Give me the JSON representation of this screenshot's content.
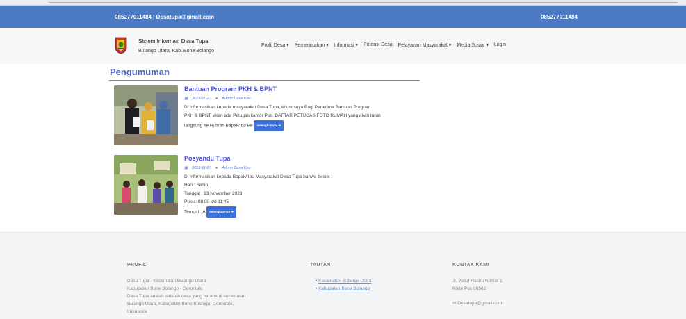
{
  "topbar": {
    "contact_left": "085277011484 | Desatupa@gmail.com",
    "contact_right": "085277011484"
  },
  "brand": {
    "title": "Sistem Informasi Desa Tupa",
    "subtitle": "Bulango Utara, Kab. Bone Bolango"
  },
  "nav": {
    "items": [
      "Profil Desa ▾",
      "Pemerintahan ▾",
      "Informasi ▾",
      "Potensi Desa",
      "Pelayanan Masyarakat ▾",
      "Media Sosial ▾",
      "Login"
    ]
  },
  "section": {
    "title": "Pengumuman"
  },
  "posts": [
    {
      "title": "Bantuan Program PKH & BPNT",
      "date": "2023-11-27",
      "author": "Admin Desa Kiru",
      "lines": [
        "Di informasikan kepada masyarakat Desa Tupa, khususnya Bagi Penerima Bantuan Program",
        "PKH & BPNT, akan ada Petugas kantor Pos. DAFTAR PETUGAS FOTO RUMAH yang akan turun",
        "langsung ke Rumah Bapak/Ibu Pe"
      ],
      "more": "selengkapnya ➔"
    },
    {
      "title": "Posyandu Tupa",
      "date": "2023-11-27",
      "author": "Admin Desa Kiru",
      "lines": [
        "Di informasikan kepada Bapak/ Ibu Masyarakat Desa Tupa bahwa besok :",
        "Hari : Senin",
        "Tanggal : 13 November 2023",
        "Pukul: 08:00 s/d 11:45",
        "Tempat : A"
      ],
      "more": "selengkapnya ➔"
    }
  ],
  "footer": {
    "profil": {
      "heading": "PROFIL",
      "lines": [
        "Desa Tupa - Kecamatan Bulango Utara",
        "Kabupaten Bone Bolango - Gorontalo",
        "Desa Tupa adalah sebuah desa yang berada di kecamatan",
        "Bulango Utara, Kabupaten Bone Bolango, Gorontalo,",
        "Indonesia"
      ]
    },
    "tautan": {
      "heading": "TAUTAN",
      "links": [
        "Kecamatan Bulango Utara",
        "Kabupaten Bone Bolango"
      ]
    },
    "kontak": {
      "heading": "KONTAK KAMI",
      "address1": "Jl. Yusuf Hasiru Nomor 1",
      "address2": "Kode Pos 96582",
      "email": "Desatupa@gmail.com"
    }
  },
  "colors": {
    "topbar": "#4b7bc4",
    "accent": "#4b67c9",
    "button": "#3b6fd9"
  },
  "icons": [
    "calendar-icon",
    "user-icon",
    "envelope-icon",
    "village-logo"
  ]
}
